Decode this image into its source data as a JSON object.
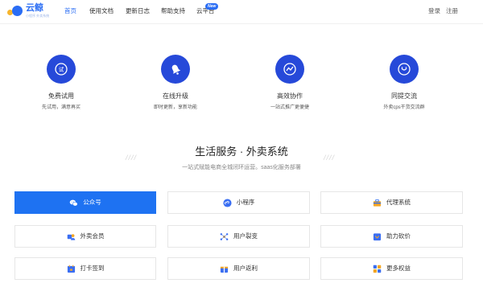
{
  "header": {
    "logo_text": "云鲸",
    "logo_sub": "小程序  外卖系统",
    "nav": [
      {
        "label": "首页",
        "active": true
      },
      {
        "label": "使用文档",
        "active": false
      },
      {
        "label": "更新日志",
        "active": false
      },
      {
        "label": "帮助支持",
        "active": false
      },
      {
        "label": "云平台",
        "active": false
      }
    ],
    "new_badge": "New",
    "login": "登录",
    "register": "注册"
  },
  "features": [
    {
      "icon": "trial-icon",
      "title": "免费试用",
      "desc": "先试用，满意再买"
    },
    {
      "icon": "bell-icon",
      "title": "在线升级",
      "desc": "即时更新，享新功能"
    },
    {
      "icon": "trend-icon",
      "title": "高效协作",
      "desc": "一站式推广更便捷"
    },
    {
      "icon": "chat-icon",
      "title": "同提交流",
      "desc": "外卖cps干货交流群"
    }
  ],
  "section": {
    "title": "生活服务 · 外卖系统",
    "subtitle": "一站式赋能电商全城闭环运营。saas化服务部署",
    "slashes": "////"
  },
  "cards": [
    {
      "label": "公众号",
      "icon": "wechat-icon",
      "active": true
    },
    {
      "label": "小程序",
      "icon": "mini-program-icon",
      "active": false
    },
    {
      "label": "代理系统",
      "icon": "briefcase-icon",
      "active": false
    },
    {
      "label": "外卖会员",
      "icon": "member-icon",
      "active": false
    },
    {
      "label": "用户裂变",
      "icon": "fission-icon",
      "active": false
    },
    {
      "label": "助力砍价",
      "icon": "bargain-icon",
      "active": false
    },
    {
      "label": "打卡签到",
      "icon": "checkin-icon",
      "active": false
    },
    {
      "label": "用户返利",
      "icon": "rebate-icon",
      "active": false
    },
    {
      "label": "更多权益",
      "icon": "more-icon",
      "active": false
    }
  ],
  "colors": {
    "primary": "#2a6df4",
    "feature_circle": "#2649d9",
    "active_card": "#1e72f2",
    "logo_yellow": "#f7b52c"
  }
}
